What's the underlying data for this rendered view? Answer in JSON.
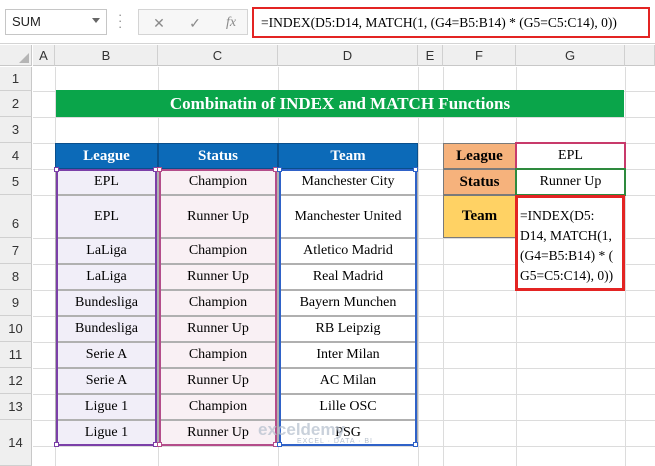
{
  "name_box": "SUM",
  "formula_bar": {
    "cancel_icon": "✕",
    "enter_icon": "✓",
    "fx_icon": "fx",
    "formula": "=INDEX(D5:D14, MATCH(1, (G4=B5:B14) * (G5=C5:C14), 0))"
  },
  "columns": [
    "A",
    "B",
    "C",
    "D",
    "E",
    "F",
    "G"
  ],
  "rows": [
    "1",
    "2",
    "3",
    "4",
    "5",
    "6",
    "7",
    "8",
    "9",
    "10",
    "11",
    "12",
    "13",
    "14"
  ],
  "title": "Combinatin of INDEX and MATCH Functions",
  "table": {
    "headers": [
      "League",
      "Status",
      "Team"
    ],
    "rows": [
      [
        "EPL",
        "Champion",
        "Manchester City"
      ],
      [
        "EPL",
        "Runner Up",
        "Manchester United"
      ],
      [
        "LaLiga",
        "Champion",
        "Atletico Madrid"
      ],
      [
        "LaLiga",
        "Runner Up",
        "Real Madrid"
      ],
      [
        "Bundesliga",
        "Champion",
        "Bayern Munchen"
      ],
      [
        "Bundesliga",
        "Runner Up",
        "RB Leipzig"
      ],
      [
        "Serie A",
        "Champion",
        "Inter Milan"
      ],
      [
        "Serie A",
        "Runner Up",
        "AC Milan"
      ],
      [
        "Ligue 1",
        "Champion",
        "Lille OSC"
      ],
      [
        "Ligue 1",
        "Runner Up",
        "PSG"
      ]
    ]
  },
  "lookup": {
    "league_label": "League",
    "league_value": "EPL",
    "status_label": "Status",
    "status_value": "Runner Up",
    "team_label": "Team",
    "team_formula_lines": [
      "=INDEX(D5:",
      "D14, MATCH(1,",
      "(G4=B5:B14) * (",
      "G5=C5:C14), 0))"
    ]
  },
  "watermark": {
    "name": "exceldemy",
    "tagline": "EXCEL · DATA · BI"
  },
  "colors": {
    "title_bg": "#0aa54a",
    "header_bg": "#0c6ab8",
    "label_bg": "#f6b27c",
    "team_label_bg": "#ffd264",
    "edit_border": "#e32423",
    "ref_b": "#7b3fa8",
    "ref_c": "#b44d8a",
    "ref_d": "#2f62c8",
    "ref_g4": "#c83a6b",
    "ref_g5": "#2e8a3e"
  }
}
